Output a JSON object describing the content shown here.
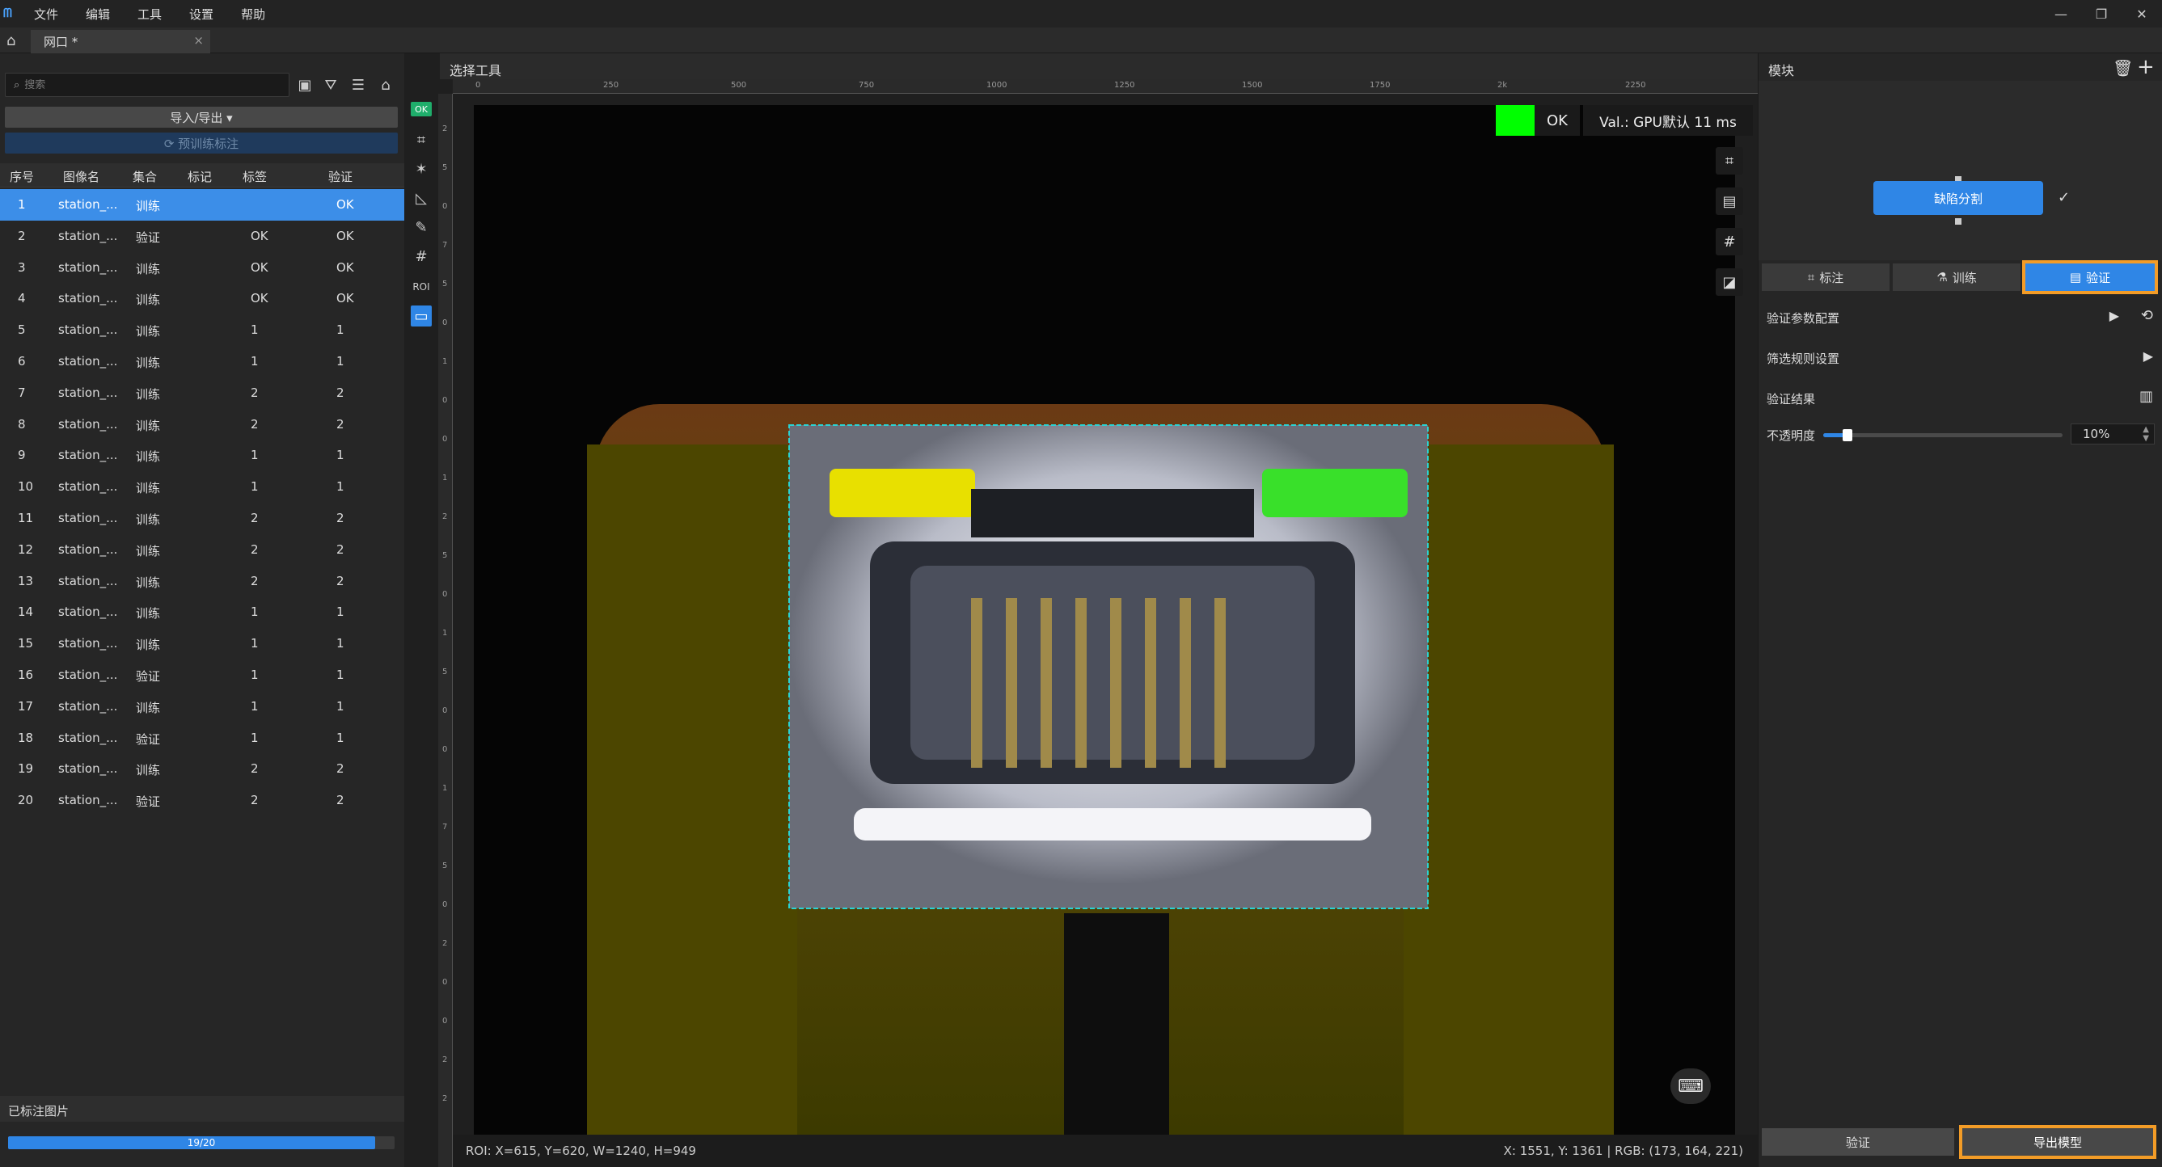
{
  "menu": {
    "logo": "ᗰ",
    "items": [
      "文件",
      "编辑",
      "工具",
      "设置",
      "帮助"
    ]
  },
  "window_controls": {
    "minimize": "—",
    "restore": "❐",
    "close": "✕"
  },
  "tab": {
    "label": "网口 *",
    "close": "×"
  },
  "left": {
    "search_placeholder": "搜索",
    "import_export_label": "导入/导出 ▾",
    "pretrain_label": "⟳ 预训练标注",
    "columns": [
      "序号",
      "图像名",
      "集合",
      "标记",
      "标签",
      "验证"
    ],
    "rows": [
      {
        "idx": "1",
        "name": "station_...",
        "set": "训练",
        "mark": "",
        "label": "",
        "verify": "OK"
      },
      {
        "idx": "2",
        "name": "station_...",
        "set": "验证",
        "mark": "OK",
        "label": "",
        "verify": "OK"
      },
      {
        "idx": "3",
        "name": "station_...",
        "set": "训练",
        "mark": "OK",
        "label": "",
        "verify": "OK"
      },
      {
        "idx": "4",
        "name": "station_...",
        "set": "训练",
        "mark": "OK",
        "label": "",
        "verify": "OK"
      },
      {
        "idx": "5",
        "name": "station_...",
        "set": "训练",
        "mark": "1",
        "label": "",
        "verify": "1"
      },
      {
        "idx": "6",
        "name": "station_...",
        "set": "训练",
        "mark": "1",
        "label": "",
        "verify": "1"
      },
      {
        "idx": "7",
        "name": "station_...",
        "set": "训练",
        "mark": "2",
        "label": "",
        "verify": "2"
      },
      {
        "idx": "8",
        "name": "station_...",
        "set": "训练",
        "mark": "2",
        "label": "",
        "verify": "2"
      },
      {
        "idx": "9",
        "name": "station_...",
        "set": "训练",
        "mark": "1",
        "label": "",
        "verify": "1"
      },
      {
        "idx": "10",
        "name": "station_...",
        "set": "训练",
        "mark": "1",
        "label": "",
        "verify": "1"
      },
      {
        "idx": "11",
        "name": "station_...",
        "set": "训练",
        "mark": "2",
        "label": "",
        "verify": "2"
      },
      {
        "idx": "12",
        "name": "station_...",
        "set": "训练",
        "mark": "2",
        "label": "",
        "verify": "2"
      },
      {
        "idx": "13",
        "name": "station_...",
        "set": "训练",
        "mark": "2",
        "label": "",
        "verify": "2"
      },
      {
        "idx": "14",
        "name": "station_...",
        "set": "训练",
        "mark": "1",
        "label": "",
        "verify": "1"
      },
      {
        "idx": "15",
        "name": "station_...",
        "set": "训练",
        "mark": "1",
        "label": "",
        "verify": "1"
      },
      {
        "idx": "16",
        "name": "station_...",
        "set": "验证",
        "mark": "1",
        "label": "",
        "verify": "1"
      },
      {
        "idx": "17",
        "name": "station_...",
        "set": "训练",
        "mark": "1",
        "label": "",
        "verify": "1"
      },
      {
        "idx": "18",
        "name": "station_...",
        "set": "验证",
        "mark": "1",
        "label": "",
        "verify": "1"
      },
      {
        "idx": "19",
        "name": "station_...",
        "set": "训练",
        "mark": "2",
        "label": "",
        "verify": "2"
      },
      {
        "idx": "20",
        "name": "station_...",
        "set": "验证",
        "mark": "2",
        "label": "",
        "verify": "2"
      }
    ],
    "labeled_title": "已标注图片",
    "progress_text": "19/20",
    "progress_fraction": 0.95
  },
  "tools": {
    "ok_badge": "OK",
    "roi_label": "ROI"
  },
  "center": {
    "title": "选择工具",
    "ruler_top": [
      "0",
      "250",
      "500",
      "750",
      "1000",
      "1250",
      "1500",
      "1750",
      "2k",
      "2250"
    ],
    "ruler_left": [
      "2",
      "5",
      "0",
      "7",
      "5",
      "0",
      "1",
      "0",
      "0",
      "1",
      "2",
      "5",
      "0",
      "1",
      "5",
      "0",
      "0",
      "1",
      "7",
      "5",
      "0",
      "2",
      "0",
      "0",
      "2",
      "2"
    ],
    "ok_text": "OK",
    "val_text": "Val.: GPU默认 11 ms",
    "roi_text": "ROI: X=615, Y=620, W=1240, H=949",
    "coord_text": "X: 1551, Y: 1361 | RGB: (173, 164, 221)"
  },
  "right": {
    "title": "模块",
    "module_name": "缺陷分割",
    "tabs": [
      "标注",
      "训练",
      "验证"
    ],
    "sec_verify_params": "验证参数配置",
    "sec_filter": "筛选规则设置",
    "sec_result": "验证结果",
    "opacity_label": "不透明度",
    "opacity_value": "10%",
    "opacity_fraction": 0.1,
    "btn_verify": "验证",
    "btn_export": "导出模型"
  },
  "colors": {
    "accent": "#2f86e6",
    "highlight": "#f39c27",
    "ok_green": "#00ff00"
  }
}
